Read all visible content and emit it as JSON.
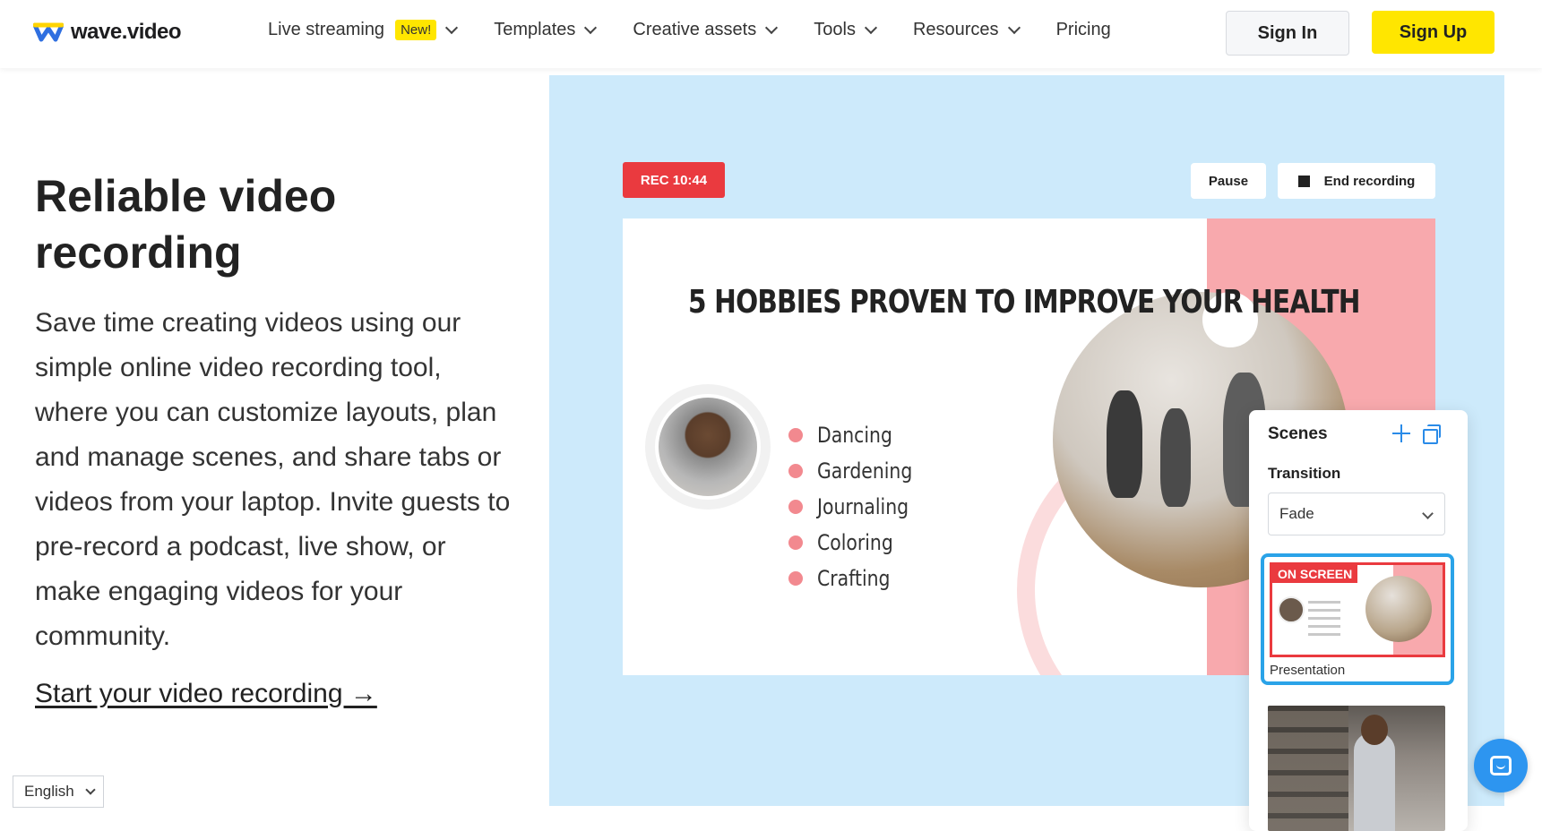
{
  "header": {
    "logo_text": "wave.video",
    "nav": [
      {
        "label": "Live streaming",
        "badge": "New!",
        "has_dropdown": true
      },
      {
        "label": "Templates",
        "has_dropdown": true
      },
      {
        "label": "Creative assets",
        "has_dropdown": true
      },
      {
        "label": "Tools",
        "has_dropdown": true
      },
      {
        "label": "Resources",
        "has_dropdown": true
      },
      {
        "label": "Pricing",
        "has_dropdown": false
      }
    ],
    "signin_label": "Sign In",
    "signup_label": "Sign Up"
  },
  "hero": {
    "title": "Reliable video recording",
    "description": "Save time creating videos using our simple online video recording tool, where you can customize layouts, plan and manage scenes, and share tabs or videos from your laptop. Invite guests to pre-record a podcast, live show, or make engaging videos for your community.",
    "cta": "Start your video recording →"
  },
  "language": {
    "selected": "English"
  },
  "recorder": {
    "rec_label": "REC 10:44",
    "pause_label": "Pause",
    "end_label": "End recording",
    "slide_title": "5 HOBBIES PROVEN TO IMPROVE YOUR HEALTH",
    "hobbies": [
      "Dancing",
      "Gardening",
      "Journaling",
      "Coloring",
      "Crafting"
    ]
  },
  "scenes": {
    "title": "Scenes",
    "transition_label": "Transition",
    "transition_value": "Fade",
    "on_screen_badge": "ON SCREEN",
    "scene1_name": "Presentation"
  },
  "colors": {
    "accent_yellow": "#ffe600",
    "rec_red": "#ea3a3f",
    "panel_bg": "#cdeafb",
    "scene_border": "#2aa3e8",
    "chat_blue": "#2d95f0"
  },
  "icons": [
    "chevron-down-icon",
    "stop-icon",
    "plus-icon",
    "duplicate-icon",
    "chat-icon"
  ]
}
